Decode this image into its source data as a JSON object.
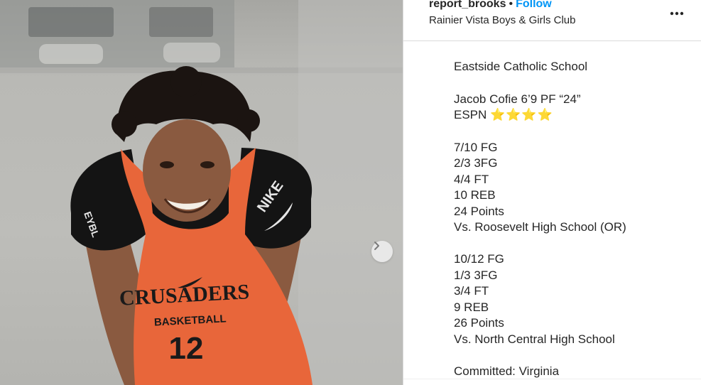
{
  "header": {
    "username": "report_brooks",
    "separator": "•",
    "follow_label": "Follow",
    "location": "Rainier Vista Boys & Girls Club"
  },
  "caption": {
    "school": "Eastside Catholic School",
    "player": "Jacob Cofie 6’9 PF “24”",
    "rating_prefix": "ESPN",
    "rating_stars": "⭐⭐⭐⭐",
    "game1": {
      "fg": "7/10 FG",
      "three_fg": "2/3 3FG",
      "ft": "4/4 FT",
      "reb": "10 REB",
      "points": "24 Points",
      "opponent": "Vs. Roosevelt High School (OR)"
    },
    "game2": {
      "fg": "10/12 FG",
      "three_fg": "1/3 3FG",
      "ft": "3/4 FT",
      "reb": "9 REB",
      "points": "26 Points",
      "opponent": "Vs. North Central High School"
    },
    "committed": "Committed: Virginia"
  },
  "photo": {
    "jersey_text": "CRUSADERS",
    "jersey_subtext": "BASKETBALL",
    "jersey_number": "12",
    "shoulder_logo": "NIKE",
    "left_shoulder_text": "EYBL"
  },
  "icons": {
    "next": "chevron-right-icon",
    "more": "more-options-icon"
  },
  "colors": {
    "follow": "#0095f6",
    "jersey": "#e8663a",
    "text": "#262626"
  }
}
